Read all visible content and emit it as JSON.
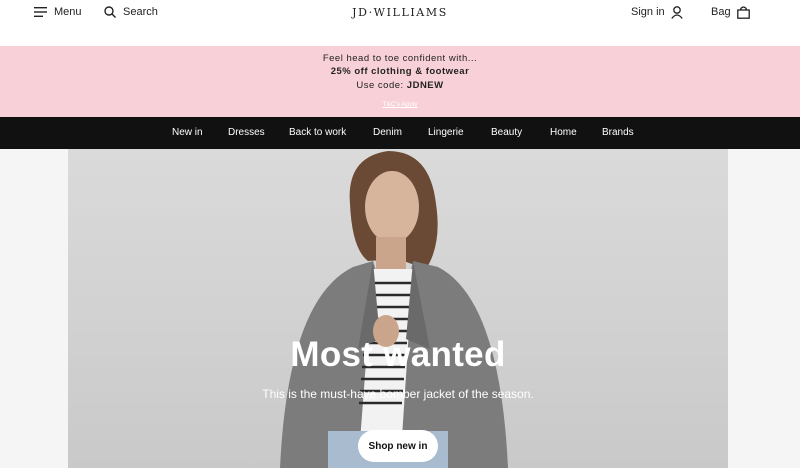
{
  "header": {
    "menu_label": "Menu",
    "search_label": "Search",
    "logo": "JD·WILLIAMS",
    "signin_label": "Sign in",
    "bag_label": "Bag"
  },
  "promo": {
    "line1": "Feel head to toe confident with...",
    "line2": "25% off clothing & footwear",
    "code_prefix": "Use code: ",
    "code": "JDNEW",
    "terms": "T&C's Apply"
  },
  "nav": {
    "items": [
      "New in",
      "Dresses",
      "Back to work",
      "Denim",
      "Lingerie",
      "Beauty",
      "Home",
      "Brands"
    ]
  },
  "hero": {
    "title": "Most wanted",
    "subtitle": "This is the must-have bomber jacket of the season.",
    "cta_label": "Shop new in"
  },
  "colors": {
    "promo_bg": "#f8d1d8",
    "nav_bg": "#111111",
    "page_bg": "#f5f5f5"
  }
}
